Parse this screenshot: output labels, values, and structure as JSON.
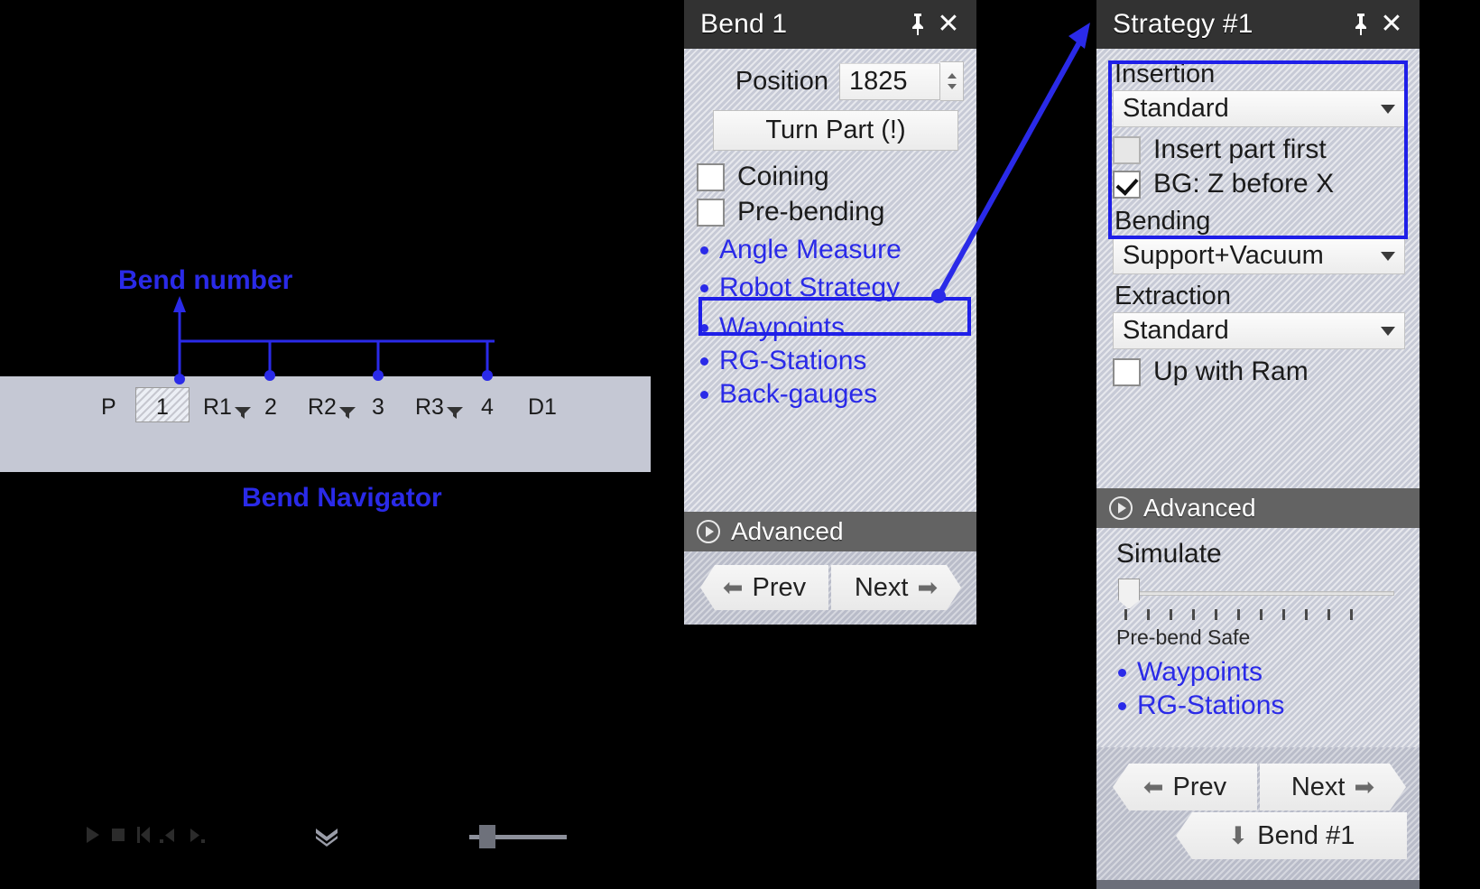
{
  "annotations": {
    "bend_number_label": "Bend number",
    "bend_navigator_label": "Bend Navigator"
  },
  "navigator": {
    "items": [
      {
        "label": "P",
        "type": "stage"
      },
      {
        "label": "1",
        "type": "bend",
        "selected": true
      },
      {
        "label": "R1",
        "type": "repo",
        "filter": true
      },
      {
        "label": "2",
        "type": "bend"
      },
      {
        "label": "R2",
        "type": "repo",
        "filter": true
      },
      {
        "label": "3",
        "type": "bend"
      },
      {
        "label": "R3",
        "type": "repo",
        "filter": true
      },
      {
        "label": "4",
        "type": "bend"
      },
      {
        "label": "D1",
        "type": "stage"
      }
    ],
    "controls": [
      "play-icon",
      "stop-icon",
      "skip-start-icon",
      "step-back-icon",
      "step-forward-icon"
    ],
    "expand_icon": "double-chevron-down-icon",
    "slider_value": 10
  },
  "bend_panel": {
    "title": "Bend 1",
    "pin_icon": "pin-icon",
    "close_icon": "close-icon",
    "position_label": "Position",
    "position_value": "1825",
    "turn_part_label": "Turn Part (!)",
    "checkboxes": [
      {
        "label": "Coining",
        "checked": false
      },
      {
        "label": "Pre-bending",
        "checked": false
      }
    ],
    "links": [
      {
        "label": "Angle Measure",
        "highlighted": false
      },
      {
        "label": "Robot Strategy",
        "highlighted": true
      },
      {
        "label": "Waypoints",
        "highlighted": false
      },
      {
        "label": "RG-Stations",
        "highlighted": false
      },
      {
        "label": "Back-gauges",
        "highlighted": false
      }
    ],
    "advanced_label": "Advanced",
    "prev_label": "Prev",
    "next_label": "Next"
  },
  "strategy_panel": {
    "title": "Strategy #1",
    "pin_icon": "pin-icon",
    "close_icon": "close-icon",
    "insertion_label": "Insertion",
    "insertion_value": "Standard",
    "insert_part_first": {
      "label": "Insert part first",
      "checked": false
    },
    "bg_z_before_x": {
      "label": "BG: Z before X",
      "checked": true
    },
    "bending_label": "Bending",
    "bending_value": "Support+Vacuum",
    "extraction_label": "Extraction",
    "extraction_value": "Standard",
    "up_with_ram": {
      "label": "Up with Ram",
      "checked": false
    },
    "advanced_label": "Advanced",
    "simulate_label": "Simulate",
    "simulate_value": 0,
    "simulate_caption": "Pre-bend Safe",
    "links": [
      {
        "label": "Waypoints"
      },
      {
        "label": "RG-Stations"
      }
    ],
    "prev_label": "Prev",
    "next_label": "Next",
    "bend_jump_label": "Bend #1",
    "down_icon": "arrow-down-icon"
  },
  "colors": {
    "accent_blue": "#2a2ae8",
    "titlebar": "#323232",
    "panel": "#c7cad6",
    "advanced_bar": "#636363"
  }
}
